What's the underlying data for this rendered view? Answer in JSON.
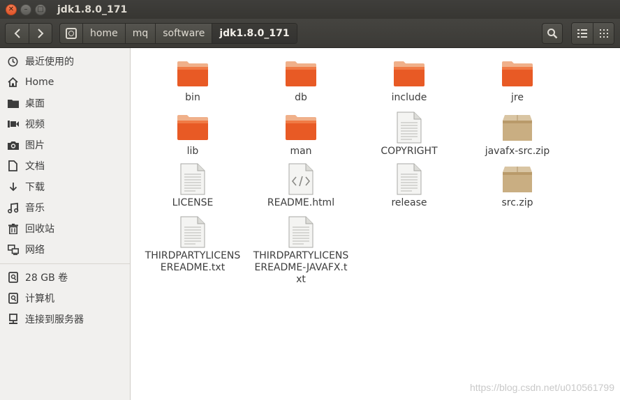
{
  "window": {
    "title": "jdk1.8.0_171"
  },
  "breadcrumbs": [
    "home",
    "mq",
    "software",
    "jdk1.8.0_171"
  ],
  "sidebar": {
    "places": [
      {
        "label": "最近使用的",
        "icon": "clock-icon"
      },
      {
        "label": "Home",
        "icon": "home-icon"
      },
      {
        "label": "桌面",
        "icon": "folder-icon"
      },
      {
        "label": "视频",
        "icon": "video-icon"
      },
      {
        "label": "图片",
        "icon": "camera-icon"
      },
      {
        "label": "文档",
        "icon": "document-icon"
      },
      {
        "label": "下载",
        "icon": "download-icon"
      },
      {
        "label": "音乐",
        "icon": "music-icon"
      },
      {
        "label": "回收站",
        "icon": "trash-icon"
      },
      {
        "label": "网络",
        "icon": "network-icon"
      }
    ],
    "devices": [
      {
        "label": "28 GB 卷",
        "icon": "drive-icon"
      },
      {
        "label": "计算机",
        "icon": "drive-icon"
      },
      {
        "label": "连接到服务器",
        "icon": "server-icon"
      }
    ]
  },
  "files": [
    {
      "name": "bin",
      "type": "folder"
    },
    {
      "name": "db",
      "type": "folder"
    },
    {
      "name": "include",
      "type": "folder"
    },
    {
      "name": "jre",
      "type": "folder"
    },
    {
      "name": "lib",
      "type": "folder"
    },
    {
      "name": "man",
      "type": "folder"
    },
    {
      "name": "COPYRIGHT",
      "type": "text"
    },
    {
      "name": "javafx-src.zip",
      "type": "zip"
    },
    {
      "name": "LICENSE",
      "type": "text"
    },
    {
      "name": "README.html",
      "type": "html"
    },
    {
      "name": "release",
      "type": "text"
    },
    {
      "name": "src.zip",
      "type": "zip"
    },
    {
      "name": "THIRDPARTYLICENSEREADME.txt",
      "type": "text"
    },
    {
      "name": "THIRDPARTYLICENSEREADME-JAVAFX.txt",
      "type": "text"
    }
  ],
  "watermark": "https://blog.csdn.net/u010561799"
}
